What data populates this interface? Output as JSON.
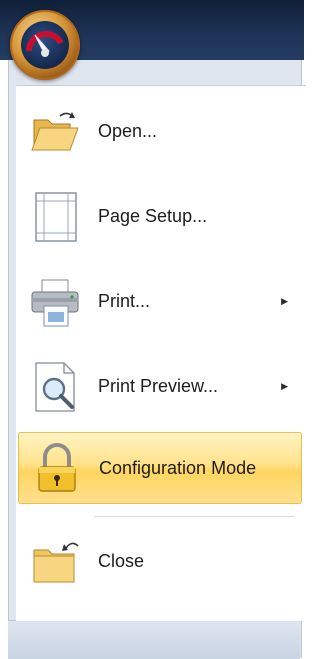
{
  "menu": {
    "items": [
      {
        "label": "Open...",
        "icon": "open-folder-icon",
        "submenu": false
      },
      {
        "label": "Page Setup...",
        "icon": "page-setup-icon",
        "submenu": false
      },
      {
        "label": "Print...",
        "icon": "printer-icon",
        "submenu": true
      },
      {
        "label": "Print Preview...",
        "icon": "print-preview-icon",
        "submenu": true
      },
      {
        "label": "Configuration Mode",
        "icon": "lock-icon",
        "submenu": false,
        "highlighted": true
      },
      {
        "label": "Close",
        "icon": "close-folder-icon",
        "submenu": false
      }
    ],
    "submenu_glyph": "▶"
  },
  "colors": {
    "highlight": "#ffd560",
    "titlebar": "#1d3356",
    "orb": "#d59535"
  }
}
